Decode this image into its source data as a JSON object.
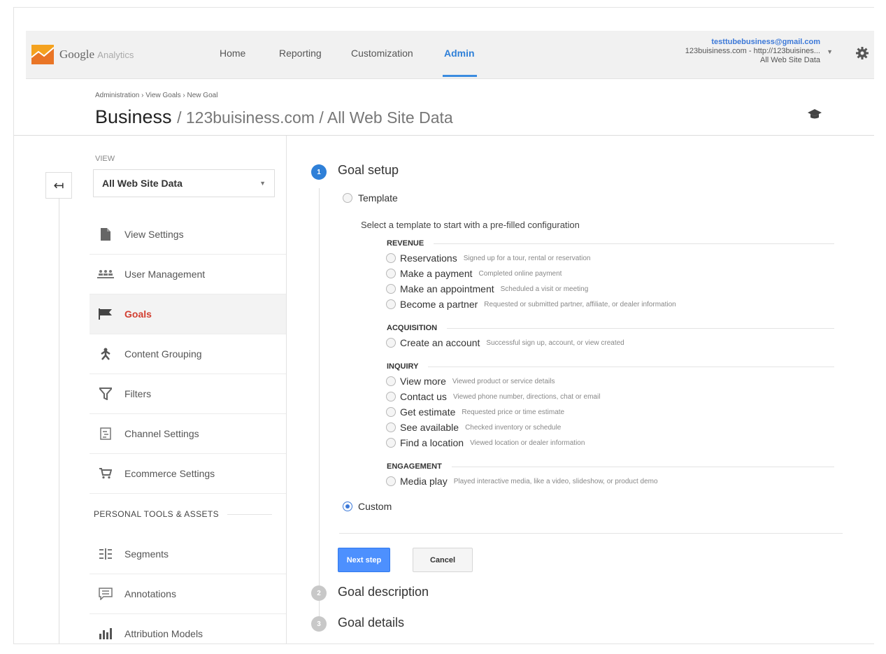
{
  "nav": {
    "logo_google": "Google",
    "logo_analytics": "Analytics",
    "items": [
      "Home",
      "Reporting",
      "Customization",
      "Admin"
    ],
    "active": "Admin"
  },
  "account": {
    "email": "testtubebusiness@gmail.com",
    "property": "123buisiness.com - http://123buisines...",
    "view": "All Web Site Data"
  },
  "header": {
    "breadcrumb": "Administration › View Goals › New Goal",
    "title": "Business",
    "title_rest": "/ 123buisiness.com / All Web Site Data"
  },
  "sidebar": {
    "view_label": "VIEW",
    "view_value": "All Web Site Data",
    "items": [
      {
        "label": "View Settings",
        "icon": "document-icon"
      },
      {
        "label": "User Management",
        "icon": "users-icon"
      },
      {
        "label": "Goals",
        "icon": "flag-icon",
        "active": true
      },
      {
        "label": "Content Grouping",
        "icon": "person-icon"
      },
      {
        "label": "Filters",
        "icon": "funnel-icon"
      },
      {
        "label": "Channel Settings",
        "icon": "channel-icon"
      },
      {
        "label": "Ecommerce Settings",
        "icon": "cart-icon"
      }
    ],
    "section": "PERSONAL TOOLS & ASSETS",
    "tools": [
      {
        "label": "Segments",
        "icon": "segments-icon"
      },
      {
        "label": "Annotations",
        "icon": "annotation-icon"
      },
      {
        "label": "Attribution Models",
        "icon": "bar-chart-icon"
      }
    ]
  },
  "goal": {
    "steps": [
      {
        "num": "1",
        "title": "Goal setup"
      },
      {
        "num": "2",
        "title": "Goal description"
      },
      {
        "num": "3",
        "title": "Goal details"
      }
    ],
    "template_label": "Template",
    "template_helper": "Select a template to start with a pre-filled configuration",
    "custom_label": "Custom",
    "categories": [
      {
        "name": "REVENUE",
        "items": [
          {
            "name": "Reservations",
            "desc": "Signed up for a tour, rental or reservation"
          },
          {
            "name": "Make a payment",
            "desc": "Completed online payment"
          },
          {
            "name": "Make an appointment",
            "desc": "Scheduled a visit or meeting"
          },
          {
            "name": "Become a partner",
            "desc": "Requested or submitted partner, affiliate, or dealer information"
          }
        ]
      },
      {
        "name": "ACQUISITION",
        "items": [
          {
            "name": "Create an account",
            "desc": "Successful sign up, account, or view created"
          }
        ]
      },
      {
        "name": "INQUIRY",
        "items": [
          {
            "name": "View more",
            "desc": "Viewed product or service details"
          },
          {
            "name": "Contact us",
            "desc": "Viewed phone number, directions, chat or email"
          },
          {
            "name": "Get estimate",
            "desc": "Requested price or time estimate"
          },
          {
            "name": "See available",
            "desc": "Checked inventory or schedule"
          },
          {
            "name": "Find a location",
            "desc": "Viewed location or dealer information"
          }
        ]
      },
      {
        "name": "ENGAGEMENT",
        "items": [
          {
            "name": "Media play",
            "desc": "Played interactive media, like a video, slideshow, or product demo"
          }
        ]
      }
    ],
    "next_label": "Next step",
    "cancel_label": "Cancel"
  },
  "colors": {
    "accent": "#2f80d8",
    "active_menu": "#d23f31",
    "button": "#4d90fe"
  }
}
